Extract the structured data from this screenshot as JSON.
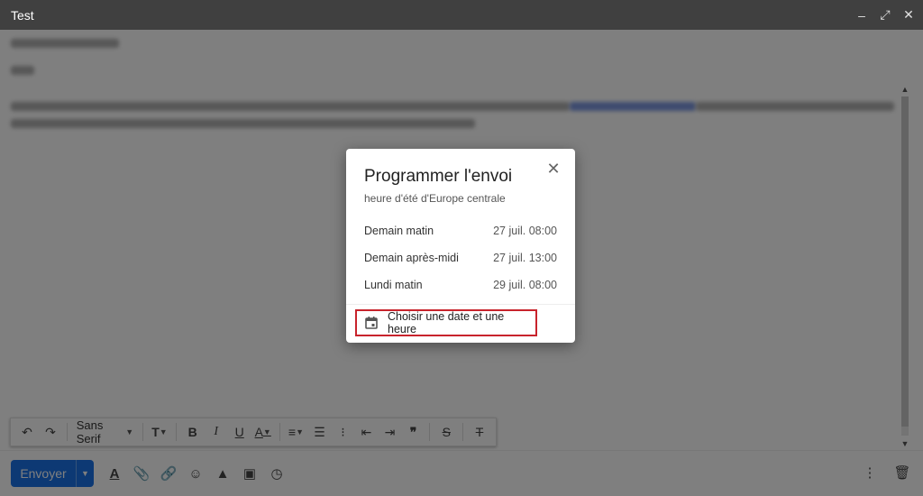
{
  "window": {
    "title": "Test",
    "controls": {
      "minimize": "‒",
      "popout": "⤢",
      "close": "✕"
    }
  },
  "compose": {
    "recipient": "",
    "subject": ""
  },
  "toolbar": {
    "font": "Sans Serif"
  },
  "bottombar": {
    "send_label": "Envoyer"
  },
  "dialog": {
    "title": "Programmer l'envoi",
    "subtitle": "heure d'été d'Europe centrale",
    "options": [
      {
        "label": "Demain matin",
        "date": "27 juil. 08:00"
      },
      {
        "label": "Demain après-midi",
        "date": "27 juil. 13:00"
      },
      {
        "label": "Lundi matin",
        "date": "29 juil. 08:00"
      }
    ],
    "custom_label": "Choisir une date et une heure"
  },
  "colors": {
    "send_blue": "#1a73e8",
    "highlight_red": "#c8232c",
    "titlebar": "#404040"
  },
  "icons": [
    "undo-icon",
    "redo-icon",
    "text-size-icon",
    "bold-icon",
    "italic-icon",
    "underline-icon",
    "text-color-icon",
    "align-icon",
    "numbered-list-icon",
    "bulleted-list-icon",
    "indent-less-icon",
    "indent-more-icon",
    "quote-icon",
    "strikethrough-icon",
    "remove-format-icon",
    "formatting-icon",
    "attach-icon",
    "link-icon",
    "emoji-icon",
    "drive-icon",
    "photo-icon",
    "schedule-icon",
    "more-options-icon",
    "trash-icon",
    "calendar-icon",
    "close-icon"
  ]
}
